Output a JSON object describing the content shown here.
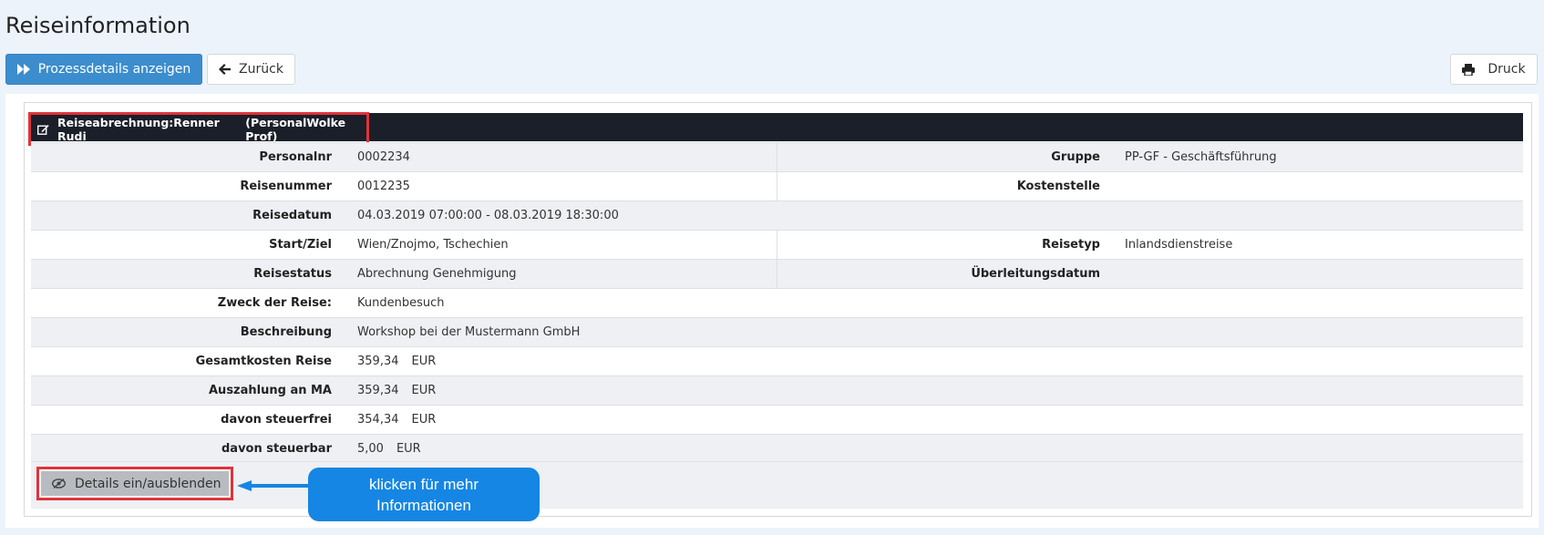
{
  "page": {
    "title": "Reiseinformation"
  },
  "toolbar": {
    "process_label": "Prozessdetails anzeigen",
    "back_label": "Zurück",
    "print_label": "Druck"
  },
  "header": {
    "title": "Reiseabrechnung:Renner Rudi",
    "org": "(PersonalWolke Prof)"
  },
  "details": {
    "personalnr_label": "Personalnr",
    "personalnr_value": "0002234",
    "gruppe_label": "Gruppe",
    "gruppe_value": "PP-GF - Geschäftsführung",
    "reisenummer_label": "Reisenummer",
    "reisenummer_value": "0012235",
    "kostenstelle_label": "Kostenstelle",
    "kostenstelle_value": "",
    "reisedatum_label": "Reisedatum",
    "reisedatum_value": "04.03.2019 07:00:00 - 08.03.2019 18:30:00",
    "startziel_label": "Start/Ziel",
    "startziel_value": "Wien/Znojmo, Tschechien",
    "reisetyp_label": "Reisetyp",
    "reisetyp_value": "Inlandsdienstreise",
    "reisestatus_label": "Reisestatus",
    "reisestatus_value": "Abrechnung Genehmigung",
    "ueberleitung_label": "Überleitungsdatum",
    "ueberleitung_value": "",
    "zweck_label": "Zweck der Reise:",
    "zweck_value": "Kundenbesuch",
    "beschreibung_label": "Beschreibung",
    "beschreibung_value": "Workshop bei der Mustermann GmbH",
    "gesamtkosten_label": "Gesamtkosten Reise",
    "gesamtkosten_value": "359,34",
    "auszahlung_label": "Auszahlung an MA",
    "auszahlung_value": "359,34",
    "steuerfrei_label": "davon steuerfrei",
    "steuerfrei_value": "354,34",
    "steuerbar_label": "davon steuerbar",
    "steuerbar_value": "5,00",
    "currency": "EUR"
  },
  "toggle": {
    "label": "Details ein/ausblenden"
  },
  "callout": {
    "line1": "klicken für mehr",
    "line2": "Informationen"
  },
  "colors": {
    "primary": "#3c8dcd",
    "header_bg": "#1a1f29",
    "highlight": "#e0333a",
    "callout": "#1586e3"
  },
  "icons": {
    "process": "fast-forward-icon",
    "back": "arrow-left-icon",
    "print": "printer-icon",
    "header": "edit-icon",
    "toggle": "eye-slash-icon"
  }
}
